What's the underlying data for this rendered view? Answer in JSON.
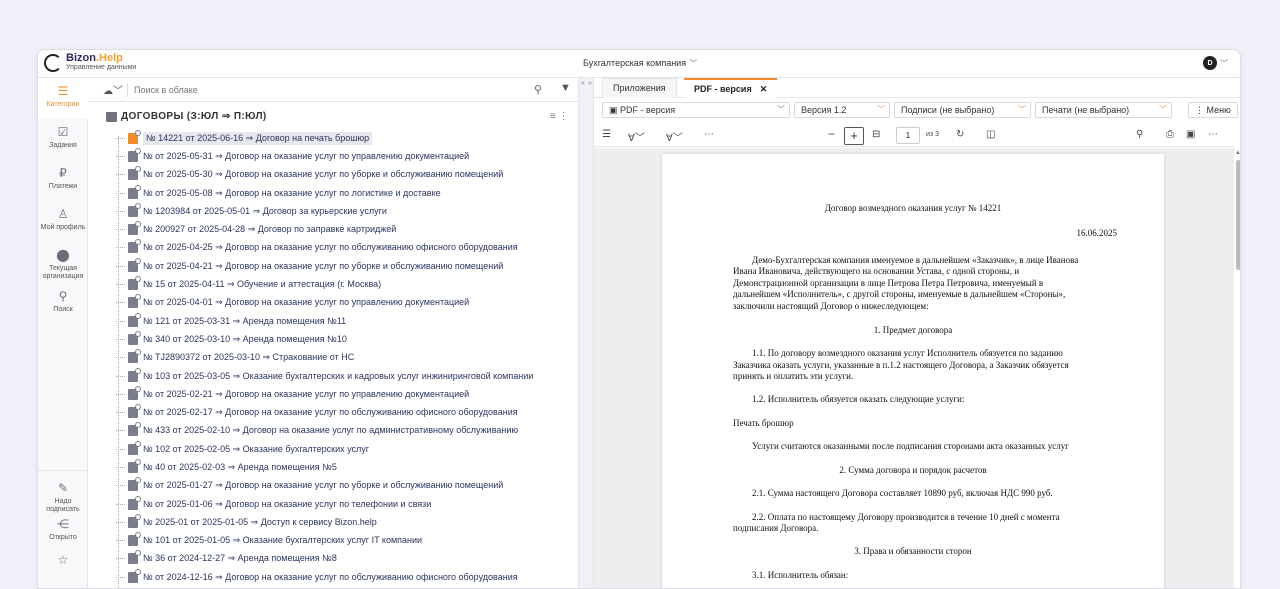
{
  "app": {
    "name_main": "Bizon",
    "name_accent": ".Help",
    "subtitle": "Управление данными"
  },
  "company": "Бухгалтерская компания",
  "user": {
    "initial": "D"
  },
  "sidebar": {
    "items": [
      {
        "label": "Категории",
        "icon": "☰"
      },
      {
        "label": "Задания",
        "icon": "☑"
      },
      {
        "label": "Платежи",
        "icon": "₽"
      },
      {
        "label": "Мой профиль",
        "icon": "♙"
      },
      {
        "label": "Текущая организация",
        "icon": "⬤"
      },
      {
        "label": "Поиск",
        "icon": "⚲"
      }
    ],
    "bottom": [
      {
        "label": "Надо подписать",
        "icon": "✎"
      },
      {
        "label": "Открыто",
        "icon": "⋲"
      },
      {
        "label": "",
        "icon": "☆"
      }
    ]
  },
  "search": {
    "placeholder": "Поиск в облаке"
  },
  "tree": {
    "title": "ДОГОВОРЫ (З:ЮЛ ⇒ П:ЮЛ)",
    "items": [
      "№ 14221 от 2025-06-16 ⇒ Договор на печать брошюр",
      "№ от 2025-05-31 ⇒ Договор на оказание услуг по управлению документацией",
      "№ от 2025-05-30 ⇒ Договор на оказание услуг по уборке и обслуживанию помещений",
      "№ от 2025-05-08 ⇒ Договор на оказание услуг по логистике и доставке",
      "№ 1203984 от 2025-05-01 ⇒ Договор за курьерские услуги",
      "№ 200927 от 2025-04-28 ⇒ Договор по заправке картриджей",
      "№ от 2025-04-25 ⇒ Договор на оказание услуг по обслуживанию офисного оборудования",
      "№ от 2025-04-21 ⇒ Договор на оказание услуг по уборке и обслуживанию помещений",
      "№ 15 от 2025-04-11 ⇒ Обучение и аттестация (г. Москва)",
      "№ от 2025-04-01 ⇒ Договор на оказание услуг по управлению документацией",
      "№ 121 от 2025-03-31 ⇒ Аренда помещения №11",
      "№ 340 от 2025-03-10 ⇒ Аренда помещения №10",
      "№ TJ2890372 от 2025-03-10 ⇒ Страхование от НС",
      "№ 103 от 2025-03-05 ⇒ Оказание бухгалтерских и кадровых услуг инжиниринговой компании",
      "№ от 2025-02-21 ⇒ Договор на оказание услуг по управлению документацией",
      "№ от 2025-02-17 ⇒ Договор на оказание услуг по обслуживанию офисного оборудования",
      "№ 433 от 2025-02-10 ⇒ Договор на оказание услуг по административному обслуживанию",
      "№ 102 от 2025-02-05 ⇒ Оказание бухгалтерских услуг",
      "№ 40 от 2025-02-03 ⇒ Аренда помещения №5",
      "№ от 2025-01-27 ⇒ Договор на оказание услуг по уборке и обслуживанию помещений",
      "№ от 2025-01-06 ⇒ Договор на оказание услуг по телефонии и связи",
      "№ 2025-01 от 2025-01-05 ⇒ Доступ к сервису Bizon.help",
      "№ 101 от 2025-01-05 ⇒ Оказание бухгалтерских услуг IT компании",
      "№ 36 от 2024-12-27 ⇒ Аренда помещения №8",
      "№ от 2024-12-16 ⇒ Договор на оказание услуг по обслуживанию офисного оборудования"
    ]
  },
  "tabs": [
    {
      "label": "Приложения"
    },
    {
      "label": "PDF - версия"
    }
  ],
  "toolbar": {
    "format": "PDF - версия",
    "version": "Версия 1.2",
    "signatures": "Подписи (не выбрано)",
    "stamps": "Печати (не выбрано)",
    "menu": "⋮ Меню"
  },
  "viewer": {
    "page": "1",
    "of": "из 3"
  },
  "document": {
    "title": "Договор возмездного оказания услуг № 14221",
    "date": "16.06.2025",
    "intro": [
      "Демо-Бухгалтерская компания именуемое в дальнейшем «Заказчик», в лице Иванова",
      "Ивана Ивановича, действующего на основании Устава, с одной стороны, и",
      "Демонстрационной организации в лице Петрова Петра Петровича, именуемый в",
      "дальнейшем «Исполнитель», с другой стороны, именуемые в дальнейшем «Стороны»,",
      "заключили настоящий Договор о нижеследующем:"
    ],
    "s1": "1. Предмет договора",
    "p11": [
      "1.1. По договору возмездного оказания услуг Исполнитель обязуется по заданию",
      "Заказчика оказать услуги, указанные в п.1.2 настоящего Договора, а Заказчик обязуется",
      "принять и оплатить эти услуги."
    ],
    "p12": "1.2. Исполнитель обязуется оказать следующие услуги:",
    "service": "Печать брошюр",
    "accepted": "Услуги считаются оказанными после подписания сторонами акта оказанных услуг",
    "s2": "2. Сумма договора и порядок расчетов",
    "p21": "2.1. Сумма настоящего Договора составляет 10890 руб, включая НДС 990 руб.",
    "p22": [
      "2.2. Оплата по настоящему Договору производится в течение 10 дней с момента",
      "подписания Договора."
    ],
    "s3": "3. Права и обязанности сторон",
    "p31": "3.1. Исполнитель обязан:"
  }
}
